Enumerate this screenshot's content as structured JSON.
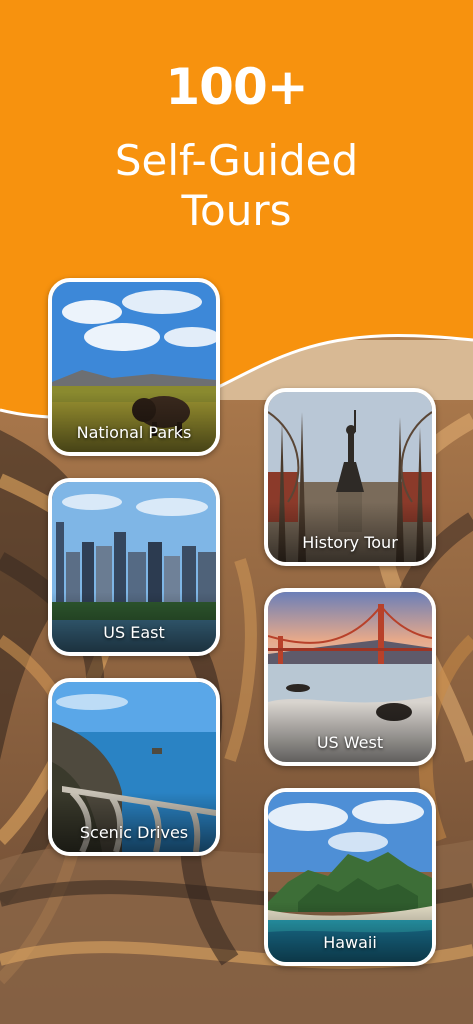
{
  "hero": {
    "count": "100+",
    "title_line1": "Self-Guided",
    "title_line2": "Tours"
  },
  "colors": {
    "accent_orange": "#F7920E",
    "card_border": "#FFFFFF"
  },
  "tours": {
    "national_parks": {
      "label": "National Parks",
      "icon": "bison-plains-photo"
    },
    "history_tour": {
      "label": "History Tour",
      "icon": "statue-park-photo"
    },
    "us_east": {
      "label": "US East",
      "icon": "city-skyline-photo"
    },
    "us_west": {
      "label": "US West",
      "icon": "golden-gate-bridge-photo"
    },
    "scenic_drives": {
      "label": "Scenic Drives",
      "icon": "coastal-bridge-photo"
    },
    "hawaii": {
      "label": "Hawaii",
      "icon": "tropical-island-photo"
    }
  }
}
